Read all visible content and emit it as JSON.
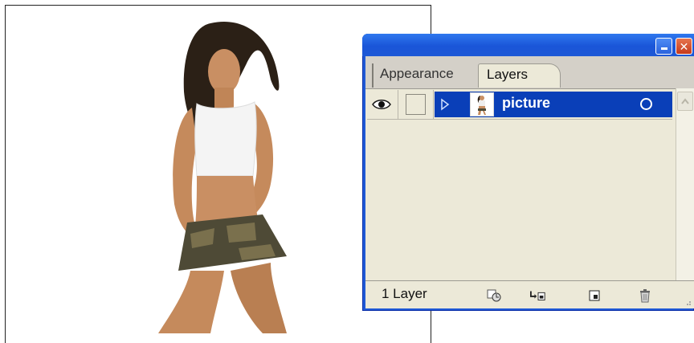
{
  "panel": {
    "tabs": [
      {
        "label": "Appearance"
      },
      {
        "label": "Layers"
      }
    ],
    "layers": [
      {
        "name": "picture",
        "visible": true,
        "selected": true
      }
    ],
    "footer": {
      "layer_count": "1 Layer"
    },
    "icons": {
      "visibility": "eye-icon",
      "expand": "triangle-right-icon",
      "target": "target-circle-icon",
      "panel_menu": "panel-menu-icon",
      "minimize": "minimize-icon",
      "close": "close-icon",
      "make_clipping_mask": "clipping-mask-icon",
      "new_sublayer": "new-sublayer-icon",
      "new_layer": "new-layer-icon",
      "delete": "trash-icon"
    },
    "colors": {
      "title_bar": "#1f59d6",
      "selected_row": "#0a3fb8",
      "panel_bg": "#ece9d8"
    }
  }
}
